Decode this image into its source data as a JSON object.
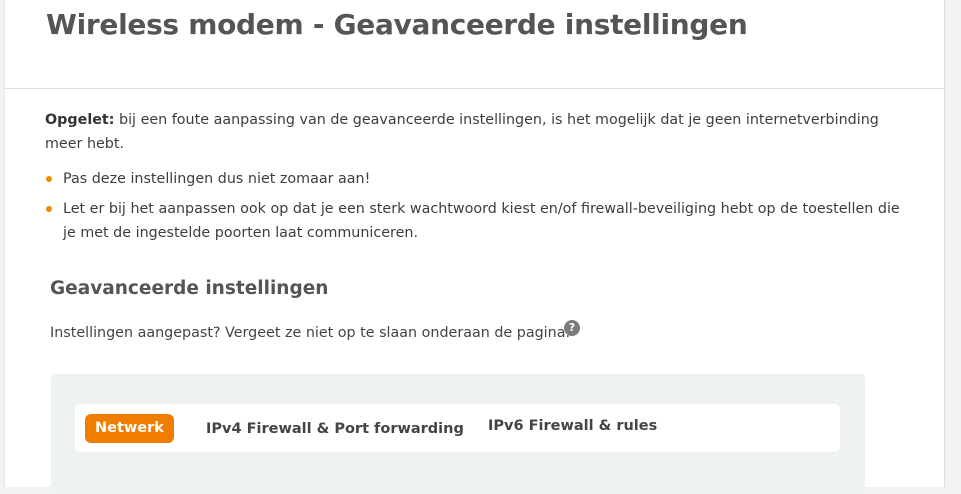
{
  "header": {
    "title": "Wireless modem - Geavanceerde instellingen"
  },
  "warning": {
    "label": "Opgelet:",
    "text": " bij een foute aanpassing van de geavanceerde instellingen, is het mogelijk dat je geen internetverbinding meer hebt."
  },
  "bullets": [
    {
      "text": "Pas deze instellingen dus niet zomaar aan!"
    },
    {
      "text": "Let er bij het aanpassen ook op dat je een sterk wachtwoord kiest en/of firewall-beveiliging hebt op de toestellen die je met de ingestelde poorten laat communiceren."
    }
  ],
  "section": {
    "title": "Geavanceerde instellingen",
    "info": "Instellingen aangepast? Vergeet ze niet op te slaan onderaan de pagina.",
    "help_glyph": "?"
  },
  "tabs": [
    {
      "label": "Netwerk",
      "active": true
    },
    {
      "label": "IPv4 Firewall & Port forwarding",
      "active": false
    },
    {
      "label": "IPv6 Firewall & rules",
      "active": false
    }
  ],
  "colors": {
    "accent": "#f07d00",
    "bullet": "#f08a00",
    "panel_bg": "#eef2f3"
  }
}
